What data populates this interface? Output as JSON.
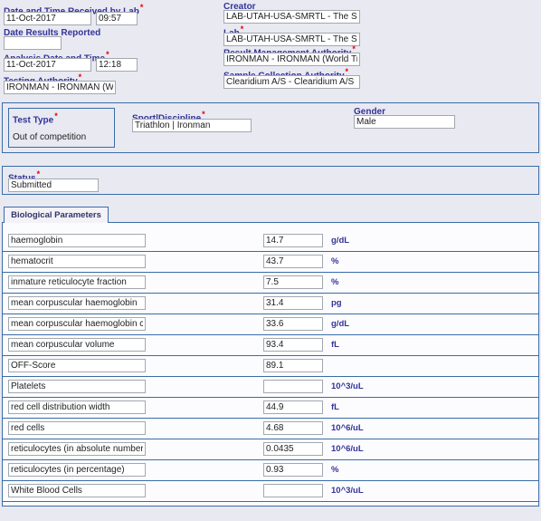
{
  "form": {
    "date_received": {
      "label": "Date and Time Received by Lab",
      "date": "11-Oct-2017",
      "time": "09:57"
    },
    "date_results_reported": {
      "label": "Date Results Reported",
      "value": ""
    },
    "analysis": {
      "label": "Analysis Date and Time",
      "date": "11-Oct-2017",
      "time": "12:18"
    },
    "testing_authority": {
      "label": "Testing Authority",
      "value": "IRONMAN - IRONMAN (Wo"
    },
    "creator": {
      "label": "Creator",
      "value": "LAB-UTAH-USA-SMRTL - The Sport"
    },
    "lab": {
      "label": "Lab",
      "value": "LAB-UTAH-USA-SMRTL - The Sport"
    },
    "result_management_authority": {
      "label": "Result Management Authority",
      "value": "IRONMAN - IRONMAN (World Triath"
    },
    "sample_collection_authority": {
      "label": "Sample Collection Authority",
      "value": "Clearidium A/S - Clearidium A/S"
    },
    "test_type": {
      "label": "Test Type",
      "value": "Out of competition"
    },
    "sport_discipline": {
      "label": "Sport|Discipline",
      "value": "Triathlon | Ironman"
    },
    "gender": {
      "label": "Gender",
      "value": "Male"
    },
    "status": {
      "label": "Status",
      "value": "Submitted"
    }
  },
  "tabs": {
    "biological_parameters": "Biological Parameters"
  },
  "parameters": [
    {
      "name": "haemoglobin",
      "value": "14.7",
      "unit": "g/dL"
    },
    {
      "name": "hematocrit",
      "value": "43.7",
      "unit": "%"
    },
    {
      "name": "inmature reticulocyte fraction",
      "value": "7.5",
      "unit": "%"
    },
    {
      "name": "mean corpuscular haemoglobin",
      "value": "31.4",
      "unit": "pg"
    },
    {
      "name": "mean corpuscular haemoglobin conc",
      "value": "33.6",
      "unit": "g/dL"
    },
    {
      "name": "mean corpuscular volume",
      "value": "93.4",
      "unit": "fL"
    },
    {
      "name": "OFF-Score",
      "value": "89.1",
      "unit": ""
    },
    {
      "name": "Platelets",
      "value": "",
      "unit": "10^3/uL"
    },
    {
      "name": "red cell distribution width",
      "value": "44.9",
      "unit": "fL"
    },
    {
      "name": "red cells",
      "value": "4.68",
      "unit": "10^6/uL"
    },
    {
      "name": "reticulocytes (in absolute number)",
      "value": "0.0435",
      "unit": "10^6/uL"
    },
    {
      "name": "reticulocytes (in percentage)",
      "value": "0.93",
      "unit": "%"
    },
    {
      "name": "White Blood Cells",
      "value": "",
      "unit": "10^3/uL"
    }
  ],
  "colors": {
    "label": "#333399",
    "required": "#e00000",
    "border_blue": "#3a6ca5",
    "page_bg": "#e9e9f2"
  }
}
